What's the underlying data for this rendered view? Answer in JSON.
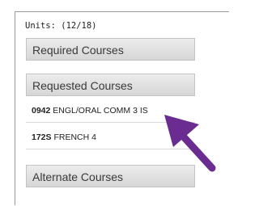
{
  "units": "Units: (12/18)",
  "sections": {
    "required": "Required Courses",
    "requested": "Requested Courses",
    "alternate": "Alternate Courses"
  },
  "courses": [
    {
      "code": "0942",
      "title": "ENGL/ORAL COMM 3 IS"
    },
    {
      "code": "172S",
      "title": "FRENCH 4"
    }
  ],
  "colors": {
    "arrow": "#6a2c91",
    "header_bg": "#dcdcdc"
  },
  "icons": {
    "pointer": "arrow-pointer-icon"
  }
}
